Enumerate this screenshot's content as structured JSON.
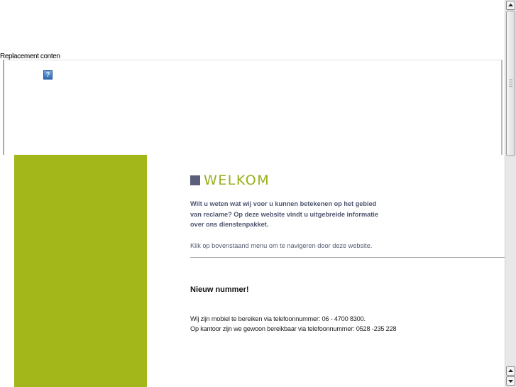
{
  "plugin": {
    "replacement_text": "Replacement conten",
    "icon": "help-question-icon",
    "icon_glyph": "?"
  },
  "welcome": {
    "title": "WELKOM",
    "intro_lines": [
      "Wilt u weten wat wij voor u kunnen betekenen op het gebied",
      "van reclame? Op deze website vindt u uitgebreide informatie",
      "over ons dienstenpakket."
    ],
    "nav_hint": "Klik op bovenstaand menu om te navigeren door deze website."
  },
  "news": {
    "heading": "Nieuw nummer!",
    "lines": [
      "Wij zijn mobiel te bereiken via telefoonnummer: 06 - 4700 8300.",
      "Op kantoor zijn we gewoon bereikbaar via telefoonnummer: 0528 -235 228"
    ]
  },
  "colors": {
    "accent_green": "#a4b71a",
    "title_green": "#9ab01c",
    "square_slate": "#5a5f7a",
    "intro_text": "#4f5570"
  },
  "scrollbars": {
    "icons": [
      "scroll-up-arrow-icon",
      "scroll-down-arrow-icon",
      "scroll-grip-icon"
    ]
  }
}
